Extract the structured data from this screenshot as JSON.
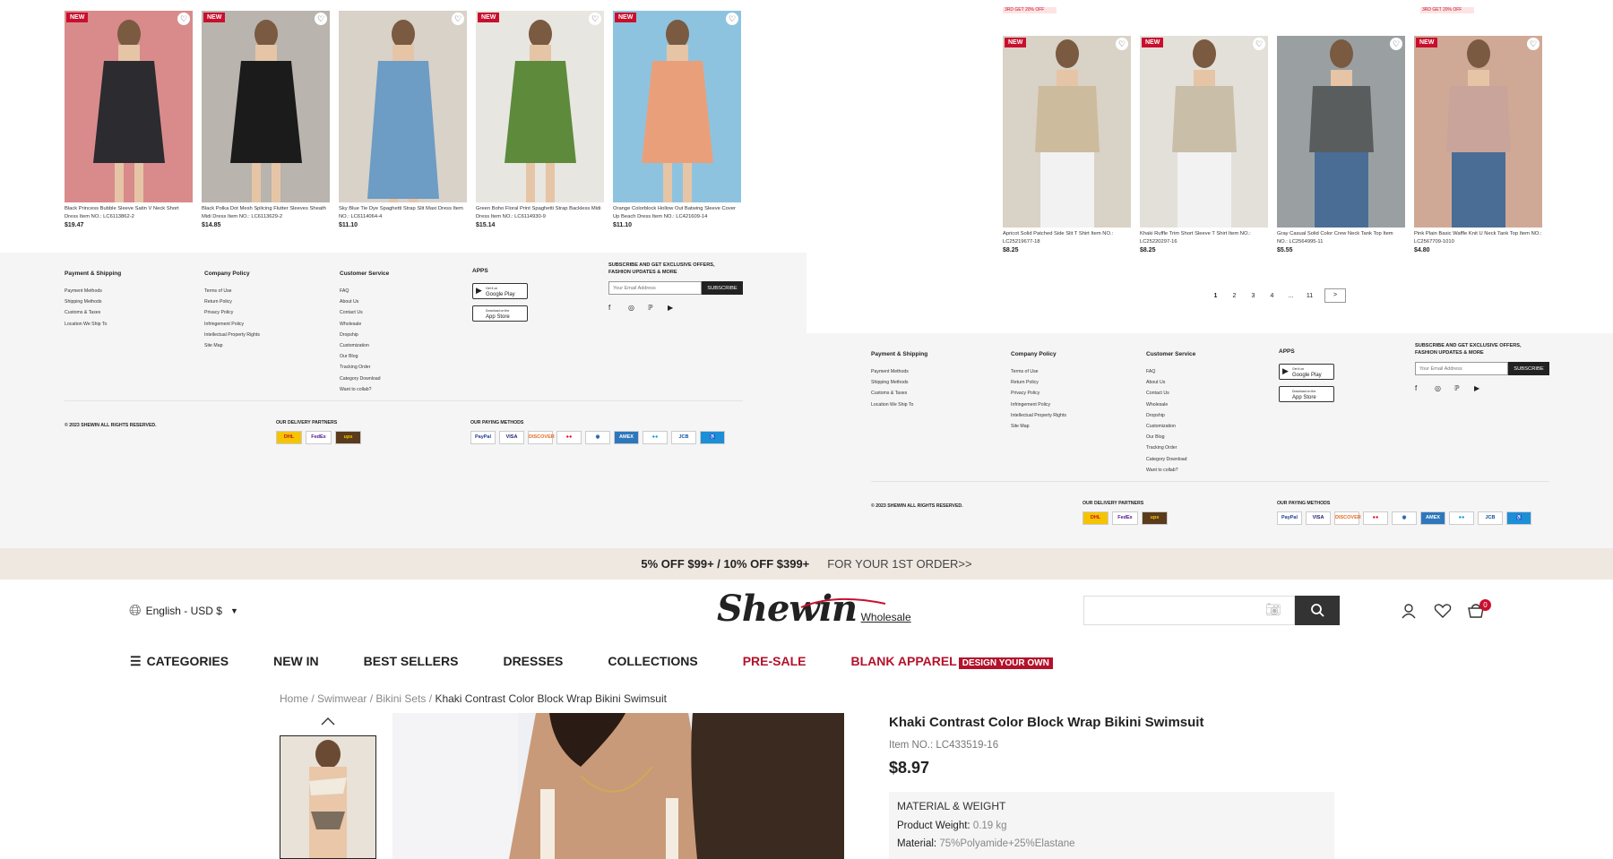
{
  "top_left_products": [
    {
      "badge": "NEW",
      "name": "Black Princess Bubble Sleeve Satin V Neck Short Dress Item NO.: LC6113862-2",
      "price": "$19.47",
      "img": [
        "#d98b8b",
        "#2b2b30"
      ]
    },
    {
      "badge": "NEW",
      "name": "Black Polka Dot Mesh Splicing Flutter Sleeves Sheath Midi Dress Item NO.: LC6113629-2",
      "price": "$14.85",
      "img": [
        "#b9b4ad",
        "#1b1b1b"
      ]
    },
    {
      "badge": "",
      "name": "Sky Blue Tie Dye Spaghetti Strap Slit Maxi Dress Item NO.: LC6114064-4",
      "price": "$11.10",
      "img": [
        "#d8d2c8",
        "#6d9cc4"
      ]
    },
    {
      "badge": "NEW",
      "name": "Green Boho Floral Print Spaghetti Strap Backless Midi Dress Item NO.: LC6114930-9",
      "price": "$15.14",
      "img": [
        "#e8e6e0",
        "#5e8a3c"
      ]
    },
    {
      "badge": "NEW",
      "name": "Orange Colorblock Hollow Out Batwing Sleeve Cover Up Beach Dress Item NO.: LC421609-14",
      "price": "$11.10",
      "img": [
        "#8ec3e0",
        "#e9a07a"
      ]
    }
  ],
  "top_right_promo": [
    "3RD GET 20% OFF",
    "3RD GET 20% OFF"
  ],
  "top_right_products": [
    {
      "badge": "NEW",
      "name": "Apricot Solid Patched Side Slit T Shirt Item NO.: LC25219677-18",
      "price": "$8.25",
      "img": [
        "#d9d2c6",
        "#cdbb9d"
      ]
    },
    {
      "badge": "NEW",
      "name": "Khaki Ruffle Trim Short Sleeve T Shirt Item NO.: LC25220297-16",
      "price": "$8.25",
      "img": [
        "#e3e0da",
        "#c9bea8"
      ]
    },
    {
      "badge": "",
      "name": "Gray Casual Solid Color Crew Neck Tank Top Item NO.: LC2564995-11",
      "price": "$5.55",
      "img": [
        "#9aa0a2",
        "#5a5d5e"
      ]
    },
    {
      "badge": "NEW",
      "name": "Pink Plain Basic Waffle Knit U Neck Tank Top Item NO.: LC2567709-1010",
      "price": "$4.80",
      "img": [
        "#d0a996",
        "#c9a49b"
      ]
    }
  ],
  "pagination": {
    "pages": [
      "1",
      "2",
      "3",
      "4",
      "...",
      "11"
    ],
    "next": ">"
  },
  "footer": {
    "payment_title": "Payment & Shipping",
    "payment_items": [
      "Payment Methods",
      "Shipping Methods",
      "Customs & Taxes",
      "Location We Ship To"
    ],
    "company_title": "Company Policy",
    "company_items": [
      "Terms of Use",
      "Return Policy",
      "Privacy Policy",
      "Infringement Policy",
      "Intellectual Property Rights",
      "Site Map"
    ],
    "service_title": "Customer Service",
    "service_items": [
      "FAQ",
      "About Us",
      "Contact Us",
      "Wholesale",
      "Dropship",
      "Customization",
      "Our Blog",
      "Tracking Order",
      "Category Download",
      "Want to collab?"
    ],
    "apps_title": "APPS",
    "google_play_top": "Get it on",
    "google_play": "Google Play",
    "app_store_top": "Download on the",
    "app_store": "App Store",
    "subscribe_title": "SUBSCRIBE AND GET EXCLUSIVE OFFERS, FASHION UPDATES & MORE",
    "email_placeholder": "Your Email Address",
    "subscribe_button": "SUBSCRIBE",
    "copyright": "© 2023 SHEWIN ALL RIGHTS RESERVED.",
    "delivery_title": "OUR DELIVERY PARTNERS",
    "delivery": [
      {
        "label": "DHL",
        "bg": "#f5c400",
        "color": "#c8102e"
      },
      {
        "label": "FedEx",
        "bg": "#ffffff",
        "color": "#4d148c"
      },
      {
        "label": "ups",
        "bg": "#5a3b1c",
        "color": "#f8c300"
      }
    ],
    "paying_title": "OUR PAYING METHODS",
    "paying": [
      {
        "label": "PayPal",
        "bg": "#ffffff",
        "color": "#1a3f8f"
      },
      {
        "label": "VISA",
        "bg": "#ffffff",
        "color": "#1a1f71"
      },
      {
        "label": "DISCOVER",
        "bg": "#ffffff",
        "color": "#e66a22"
      },
      {
        "label": "●●",
        "bg": "#ffffff",
        "color": "#eb001b"
      },
      {
        "label": "◉",
        "bg": "#ffffff",
        "color": "#1a5fa8"
      },
      {
        "label": "AMEX",
        "bg": "#2e77bc",
        "color": "#ffffff"
      },
      {
        "label": "●●",
        "bg": "#ffffff",
        "color": "#0099df"
      },
      {
        "label": "JCB",
        "bg": "#ffffff",
        "color": "#0b4ea2"
      },
      {
        "label": "♿",
        "bg": "#1c8fd6",
        "color": "#ffffff"
      }
    ]
  },
  "promo_bar": {
    "bold": "5% OFF $99+ / 10% OFF $399+",
    "text": "FOR YOUR 1ST ORDER>>"
  },
  "header": {
    "language": "English - USD $",
    "logo": "Shewin",
    "logo_sub": "Wholesale",
    "search_placeholder": "",
    "cart_count": "0"
  },
  "nav": [
    {
      "label": "CATEGORIES",
      "color": "#222"
    },
    {
      "label": "NEW IN",
      "color": "#222"
    },
    {
      "label": "BEST SELLERS",
      "color": "#222"
    },
    {
      "label": "DRESSES",
      "color": "#222"
    },
    {
      "label": "COLLECTIONS",
      "color": "#222"
    },
    {
      "label": "PRE-SALE",
      "color": "#b3122b"
    },
    {
      "label": "BLANK APPAREL",
      "color": "#b3122b"
    }
  ],
  "nav_badge": "DESIGN YOUR OWN",
  "breadcrumb": {
    "home": "Home",
    "swimwear": "Swimwear",
    "bikini": "Bikini Sets",
    "current": "Khaki Contrast Color Block Wrap Bikini Swimsuit"
  },
  "product": {
    "title": "Khaki Contrast Color Block Wrap Bikini Swimsuit",
    "item_no": "Item NO.: LC433519-16",
    "price": "$8.97",
    "mw_title": "MATERIAL & WEIGHT",
    "weight_label": "Product Weight:",
    "weight_value": "0.19 kg",
    "material_label": "Material:",
    "material_value": "75%Polyamide+25%Elastane"
  },
  "colors": {
    "accent": "#c8102e",
    "footer_bg": "#f5f5f5",
    "promo_bg": "#efe8e0"
  }
}
